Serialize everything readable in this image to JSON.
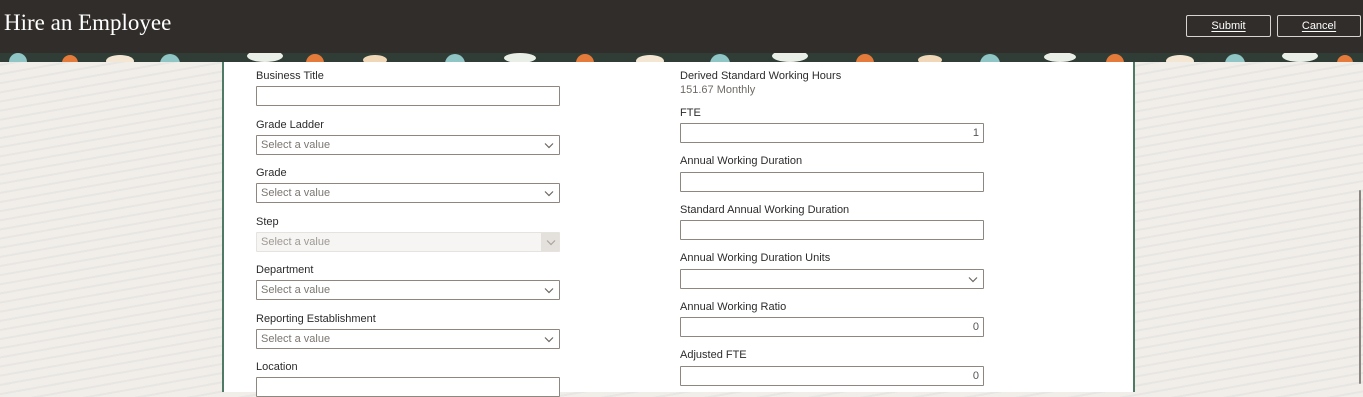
{
  "header": {
    "title": "Hire an Employee",
    "submit_label": "Submit",
    "cancel_label": "Cancel"
  },
  "left_column": {
    "business_title": {
      "label": "Business Title",
      "value": ""
    },
    "grade_ladder": {
      "label": "Grade Ladder",
      "placeholder": "Select a value"
    },
    "grade": {
      "label": "Grade",
      "placeholder": "Select a value"
    },
    "step": {
      "label": "Step",
      "placeholder": "Select a value",
      "disabled": true
    },
    "department": {
      "label": "Department",
      "placeholder": "Select a value"
    },
    "reporting_establishment": {
      "label": "Reporting Establishment",
      "placeholder": "Select a value"
    },
    "location": {
      "label": "Location",
      "placeholder": ""
    }
  },
  "right_column": {
    "derived_hours": {
      "label": "Derived Standard Working Hours",
      "value": "151.67 Monthly"
    },
    "fte": {
      "label": "FTE",
      "value": "1"
    },
    "annual_working_duration": {
      "label": "Annual Working Duration",
      "value": ""
    },
    "standard_annual_working_duration": {
      "label": "Standard Annual Working Duration",
      "value": ""
    },
    "annual_working_duration_units": {
      "label": "Annual Working Duration Units",
      "value": ""
    },
    "annual_working_ratio": {
      "label": "Annual Working Ratio",
      "value": "0"
    },
    "adjusted_fte": {
      "label": "Adjusted FTE",
      "value": "0"
    }
  },
  "icons": {
    "dropdown": "chevron-down-icon"
  },
  "colors": {
    "header_bg": "#312d2a",
    "panel_border": "#4f7a65",
    "field_border": "#8d8780"
  }
}
